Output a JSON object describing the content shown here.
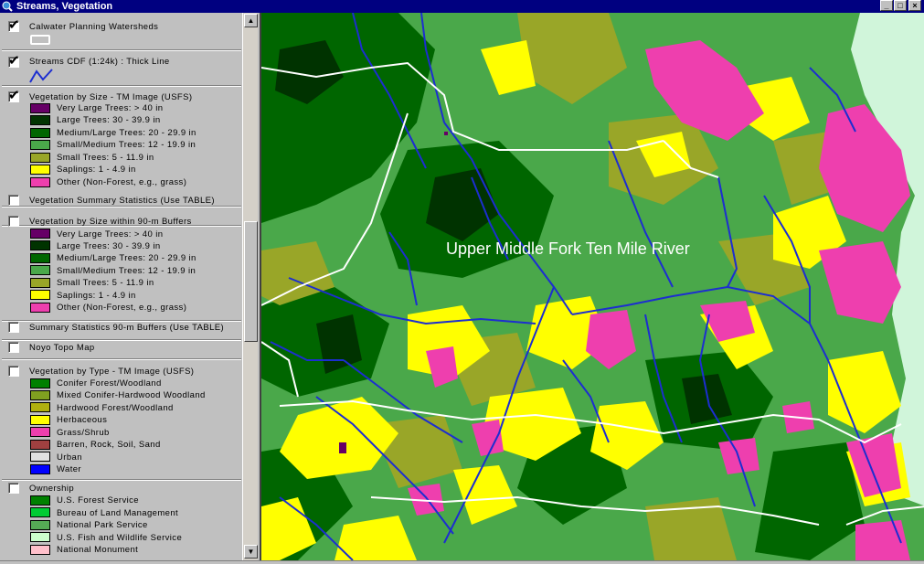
{
  "window": {
    "title": "Streams, Vegetation"
  },
  "colors": {
    "very_large": "#660066",
    "large": "#003300",
    "medium_large": "#006600",
    "small_medium": "#4aa84a",
    "small": "#99a628",
    "saplings": "#ffff00",
    "other": "#ee3fae",
    "stream": "#1c2ed0",
    "watershed": "#ffffff",
    "conifer": "#008000",
    "mixed": "#80a020",
    "hardwood": "#b0b010",
    "herbaceous": "#ffff00",
    "grass": "#ee3fae",
    "barren": "#a04040",
    "urban": "#e0e0e0",
    "water": "#0000ff",
    "usfs": "#008000",
    "blm": "#00cc33",
    "nps": "#55aa55",
    "usfws": "#ccffcc",
    "monument": "#ffc0cb",
    "ocean": "#d0f5da"
  },
  "legend": {
    "themes": [
      {
        "label": "Calwater Planning Watersheds",
        "checked": true,
        "symbol": "polygon-outline"
      },
      {
        "label": "Streams CDF (1:24k) : Thick Line",
        "checked": true,
        "symbol": "line"
      },
      {
        "label": "Vegetation by Size - TM Image (USFS)",
        "checked": true,
        "classes": [
          {
            "label": "Very Large Trees: > 40  in",
            "color": "#660066"
          },
          {
            "label": "Large Trees: 30 - 39.9 in",
            "color": "#003300"
          },
          {
            "label": "Medium/Large Trees: 20 - 29.9 in",
            "color": "#006600"
          },
          {
            "label": "Small/Medium Trees: 12 - 19.9 in",
            "color": "#4aa84a"
          },
          {
            "label": "Small Trees: 5 - 11.9 in",
            "color": "#99a628"
          },
          {
            "label": "Saplings: 1 - 4.9 in",
            "color": "#ffff00"
          },
          {
            "label": "Other (Non-Forest, e.g., grass)",
            "color": "#ee3fae"
          }
        ]
      },
      {
        "label": "Vegetation Summary Statistics (Use TABLE)",
        "checked": false
      },
      {
        "label": "Vegetation by Size within 90-m Buffers",
        "checked": false,
        "classes": [
          {
            "label": "Very Large Trees: > 40  in",
            "color": "#660066"
          },
          {
            "label": "Large Trees: 30 - 39.9 in",
            "color": "#003300"
          },
          {
            "label": "Medium/Large Trees: 20 - 29.9 in",
            "color": "#006600"
          },
          {
            "label": "Small/Medium Trees: 12 - 19.9 in",
            "color": "#4aa84a"
          },
          {
            "label": "Small Trees: 5 - 11.9 in",
            "color": "#99a628"
          },
          {
            "label": "Saplings: 1 - 4.9 in",
            "color": "#ffff00"
          },
          {
            "label": "Other (Non-Forest, e.g., grass)",
            "color": "#ee3fae"
          }
        ]
      },
      {
        "label": "Summary Statistics 90-m Buffers (Use TABLE)",
        "checked": false
      },
      {
        "label": "Noyo Topo Map",
        "checked": false
      },
      {
        "label": "Vegetation by Type - TM Image (USFS)",
        "checked": false,
        "classes": [
          {
            "label": "Conifer Forest/Woodland",
            "color": "#008000"
          },
          {
            "label": "Mixed Conifer-Hardwood Woodland",
            "color": "#80a020"
          },
          {
            "label": "Hardwood Forest/Woodland",
            "color": "#b0b010"
          },
          {
            "label": "Herbaceous",
            "color": "#ffff00"
          },
          {
            "label": "Grass/Shrub",
            "color": "#ee3fae"
          },
          {
            "label": "Barren, Rock, Soil, Sand",
            "color": "#a04040"
          },
          {
            "label": "Urban",
            "color": "#e0e0e0"
          },
          {
            "label": "Water",
            "color": "#0000ff"
          }
        ]
      },
      {
        "label": "Ownership",
        "checked": false,
        "classes": [
          {
            "label": "U.S. Forest Service",
            "color": "#008000"
          },
          {
            "label": "Bureau of Land Management",
            "color": "#00cc33"
          },
          {
            "label": "National Park Service",
            "color": "#55aa55"
          },
          {
            "label": "U.S. Fish and Wildlife Service",
            "color": "#ccffcc"
          },
          {
            "label": "National Monument",
            "color": "#ffc0cb"
          }
        ]
      }
    ]
  },
  "map": {
    "label": "Upper Middle Fork Ten Mile River"
  }
}
